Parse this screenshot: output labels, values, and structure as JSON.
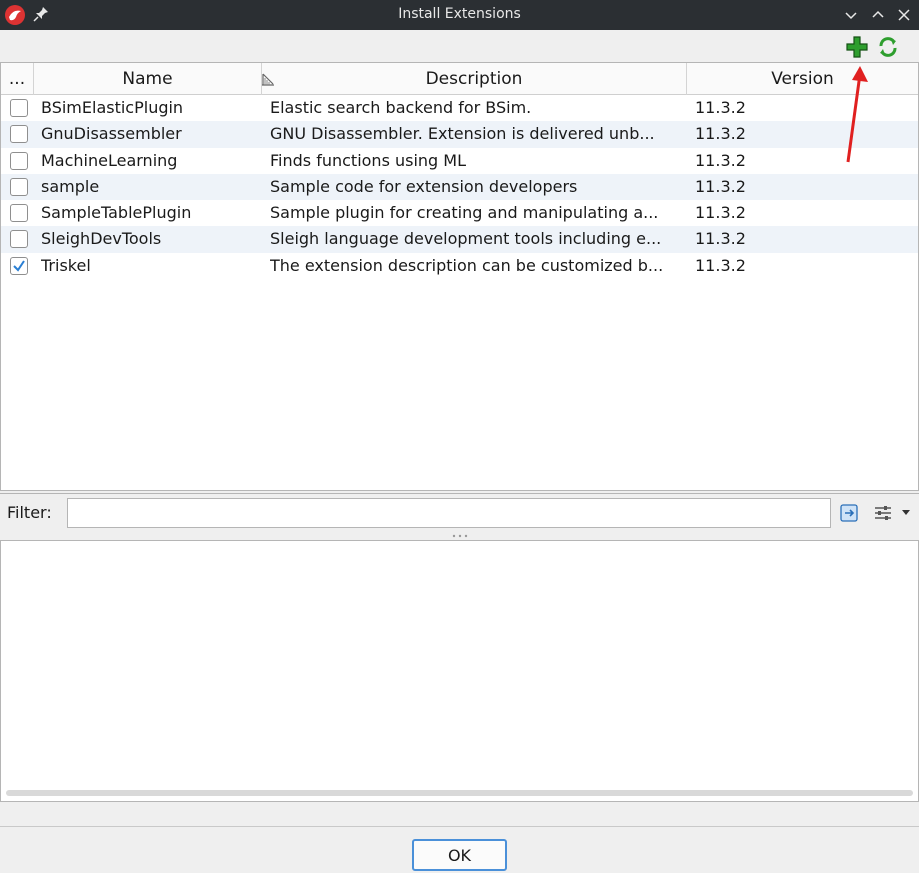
{
  "window": {
    "title": "Install Extensions",
    "colors": {
      "titlebar": "#2b2f33",
      "accent": "#4a90d9",
      "arrow": "#e02020",
      "add": "#2e9e2e"
    }
  },
  "toolbar": {
    "add_icon": "add-extension-icon",
    "refresh_icon": "refresh-icon"
  },
  "table": {
    "columns": [
      {
        "label": "..."
      },
      {
        "label": "Name"
      },
      {
        "label": "Description"
      },
      {
        "label": "Version"
      }
    ],
    "rows": [
      {
        "checked": false,
        "name": "BSimElasticPlugin",
        "description": "Elastic search backend for BSim.",
        "version": "11.3.2"
      },
      {
        "checked": false,
        "name": "GnuDisassembler",
        "description": "GNU Disassembler.  Extension is delivered unb...",
        "version": "11.3.2"
      },
      {
        "checked": false,
        "name": "MachineLearning",
        "description": "Finds functions using ML",
        "version": "11.3.2"
      },
      {
        "checked": false,
        "name": "sample",
        "description": "Sample code for extension developers",
        "version": "11.3.2"
      },
      {
        "checked": false,
        "name": "SampleTablePlugin",
        "description": "Sample plugin for creating and manipulating a...",
        "version": "11.3.2"
      },
      {
        "checked": false,
        "name": "SleighDevTools",
        "description": "Sleigh language development tools including e...",
        "version": "11.3.2"
      },
      {
        "checked": true,
        "name": "Triskel",
        "description": "The extension description can be customized b...",
        "version": "11.3.2"
      }
    ]
  },
  "filter": {
    "label": "Filter:",
    "value": ""
  },
  "footer": {
    "ok_label": "OK"
  }
}
